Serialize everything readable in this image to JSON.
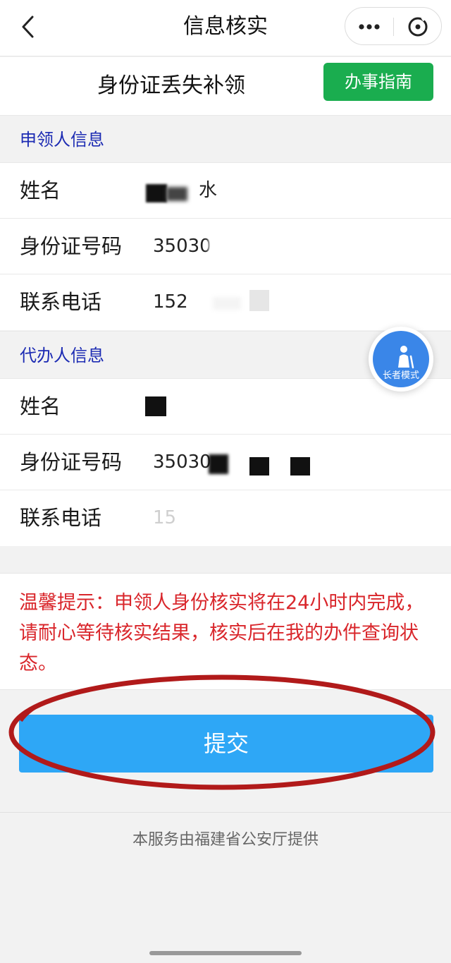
{
  "nav": {
    "title": "信息核实"
  },
  "header": {
    "title": "身份证丢失补领",
    "guide_button": "办事指南"
  },
  "applicant": {
    "section_title": "申领人信息",
    "rows": [
      {
        "label": "姓名",
        "value": "水"
      },
      {
        "label": "身份证号码",
        "value": "35030"
      },
      {
        "label": "联系电话",
        "value": "152"
      }
    ]
  },
  "agent": {
    "section_title": "代办人信息",
    "rows": [
      {
        "label": "姓名",
        "value": ""
      },
      {
        "label": "身份证号码",
        "value": "35030"
      },
      {
        "label": "联系电话",
        "value": "15"
      }
    ]
  },
  "elder_mode": {
    "label": "长者模式"
  },
  "tip": {
    "text": "温馨提示：申领人身份核实将在24小时内完成，请耐心等待核实结果，核实后在我的办件查询状态。"
  },
  "submit": {
    "label": "提交"
  },
  "footer": {
    "text": "本服务由福建省公安厅提供"
  },
  "colors": {
    "accent_green": "#1aad4f",
    "section_title_blue": "#1c2bb3",
    "tip_red": "#d9262b",
    "submit_blue": "#2ea7f6",
    "annotation_red": "#b11a1a"
  }
}
